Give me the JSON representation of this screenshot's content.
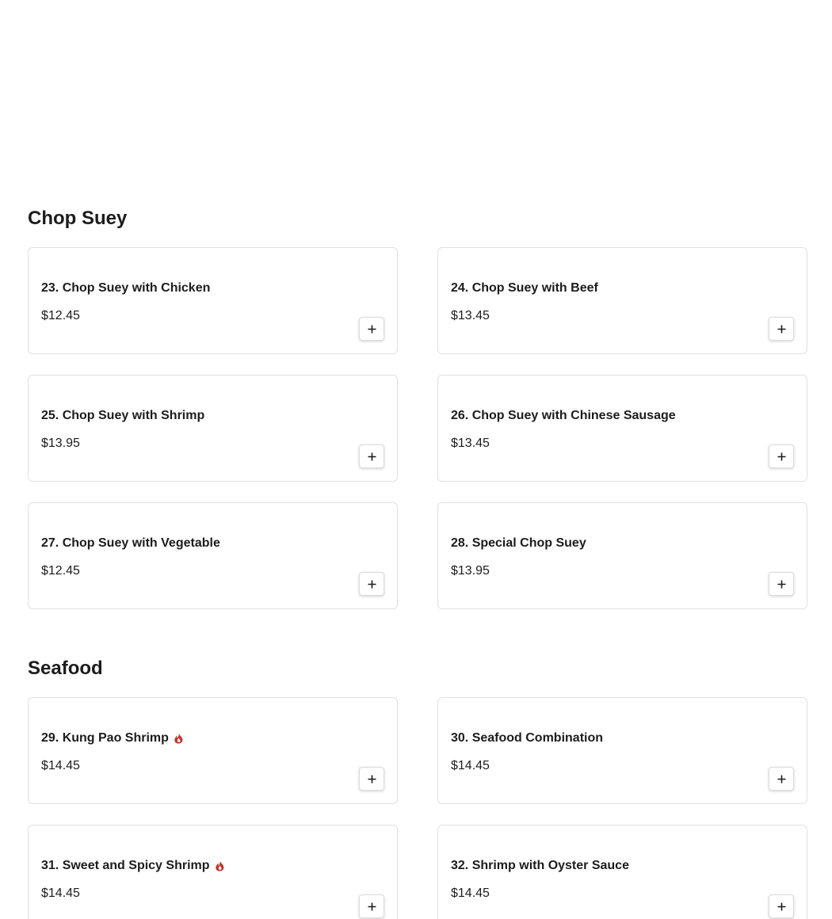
{
  "sections": [
    {
      "title": "Chop Suey",
      "items": [
        {
          "name": "23. Chop Suey with Chicken",
          "price": "$12.45",
          "spicy": false
        },
        {
          "name": "24. Chop Suey with Beef",
          "price": "$13.45",
          "spicy": false
        },
        {
          "name": "25. Chop Suey with Shrimp",
          "price": "$13.95",
          "spicy": false
        },
        {
          "name": "26. Chop Suey with Chinese Sausage",
          "price": "$13.45",
          "spicy": false
        },
        {
          "name": "27. Chop Suey with Vegetable",
          "price": "$12.45",
          "spicy": false
        },
        {
          "name": "28. Special Chop Suey",
          "price": "$13.95",
          "spicy": false
        }
      ]
    },
    {
      "title": "Seafood",
      "items": [
        {
          "name": "29. Kung Pao Shrimp",
          "price": "$14.45",
          "spicy": true
        },
        {
          "name": "30. Seafood Combination",
          "price": "$14.45",
          "spicy": false
        },
        {
          "name": "31. Sweet and Spicy Shrimp",
          "price": "$14.45",
          "spicy": true
        },
        {
          "name": "32. Shrimp with Oyster Sauce",
          "price": "$14.45",
          "spicy": false
        }
      ]
    }
  ],
  "icons": {
    "add": "plus-icon",
    "spicy": "flame-icon"
  },
  "colors": {
    "spicy": "#c8312a",
    "text": "#1c1c1c",
    "border": "#e1e1e1"
  }
}
